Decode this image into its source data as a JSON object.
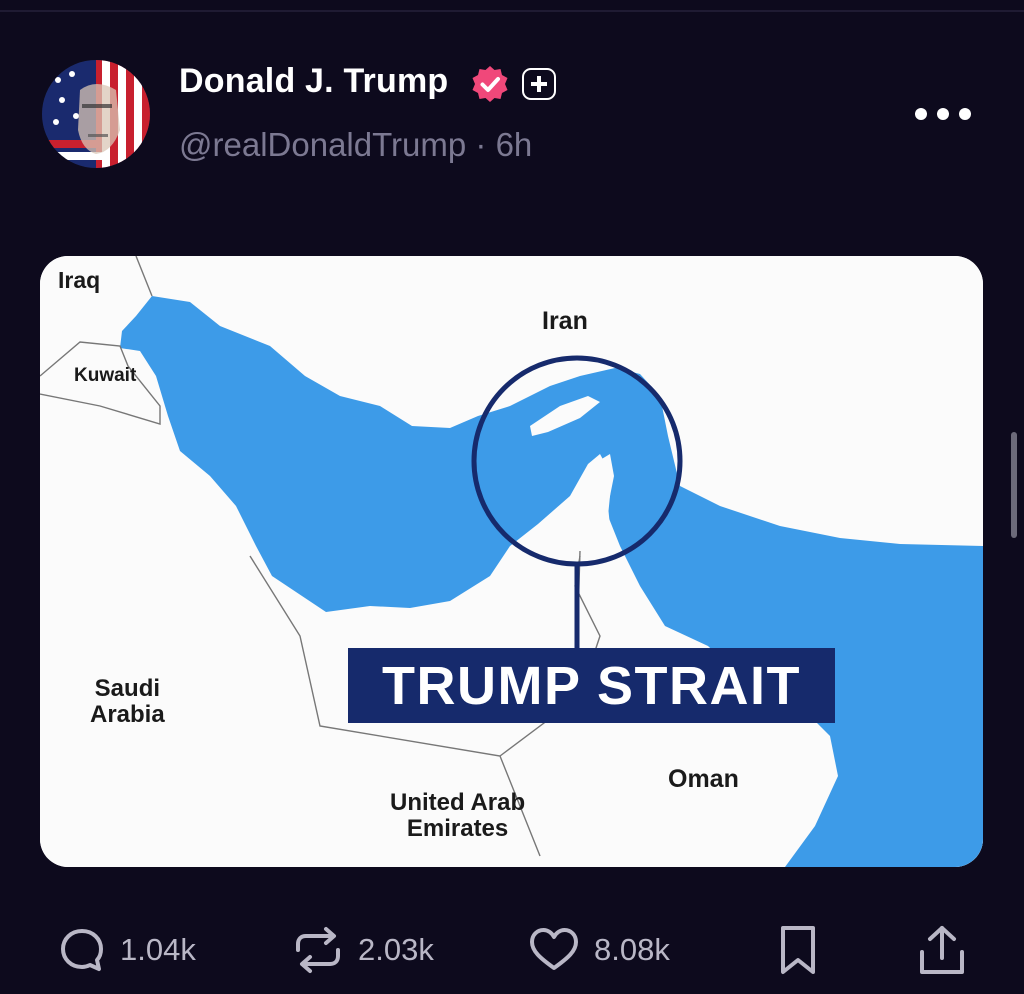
{
  "post": {
    "author_name": "Donald J. Trump",
    "handle": "@realDonaldTrump",
    "separator": "·",
    "time_ago": "6h"
  },
  "icons": {
    "verified": "verified-badge-icon",
    "plus": "plus-badge-icon",
    "more": "more-options-icon"
  },
  "map": {
    "labels": {
      "iraq": "Iraq",
      "iran": "Iran",
      "kuwait": "Kuwait",
      "saudi_arabia": "Saudi\nArabia",
      "uae": "United Arab\nEmirates",
      "oman": "Oman"
    },
    "banner": "TRUMP STRAIT",
    "colors": {
      "water": "#3d9be8",
      "land": "#fbfbfb",
      "banner": "#162a6c",
      "circle": "#162a6c"
    }
  },
  "actions": {
    "replies": "1.04k",
    "reposts": "2.03k",
    "likes": "8.08k"
  },
  "colors": {
    "background": "#0d0a1d",
    "verified_badge": "#f0487a",
    "muted_text": "#7c7992"
  }
}
